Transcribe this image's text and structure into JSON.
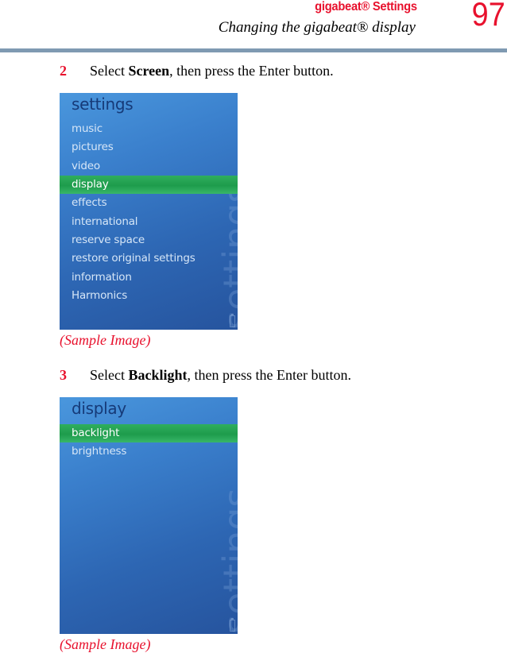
{
  "header": {
    "section": "gigabeat® Settings",
    "subtitle": "Changing the gigabeat® display",
    "page_number": "97"
  },
  "steps": [
    {
      "number": "2",
      "pre": "Select ",
      "bold": "Screen",
      "post": ", then press the Enter button."
    },
    {
      "number": "3",
      "pre": "Select ",
      "bold": "Backlight",
      "post": ", then press the Enter button."
    }
  ],
  "screens": [
    {
      "title": "settings",
      "items": [
        "music",
        "pictures",
        "video",
        "display",
        "effects",
        "international",
        "reserve space",
        "restore original settings",
        "information",
        "Harmonics"
      ],
      "selected_index": 3,
      "watermark": "settings",
      "battery_icon": "battery-icon"
    },
    {
      "title": "display",
      "items": [
        "backlight",
        "brightness"
      ],
      "selected_index": 0,
      "watermark": "settings",
      "battery_icon": "battery-icon"
    }
  ],
  "caption": "(Sample Image)",
  "colors": {
    "accent_red": "#e8112d",
    "header_bar": "#7f9ab2",
    "selection_green": "#22a452",
    "screen_blue": "#2d66b3"
  }
}
